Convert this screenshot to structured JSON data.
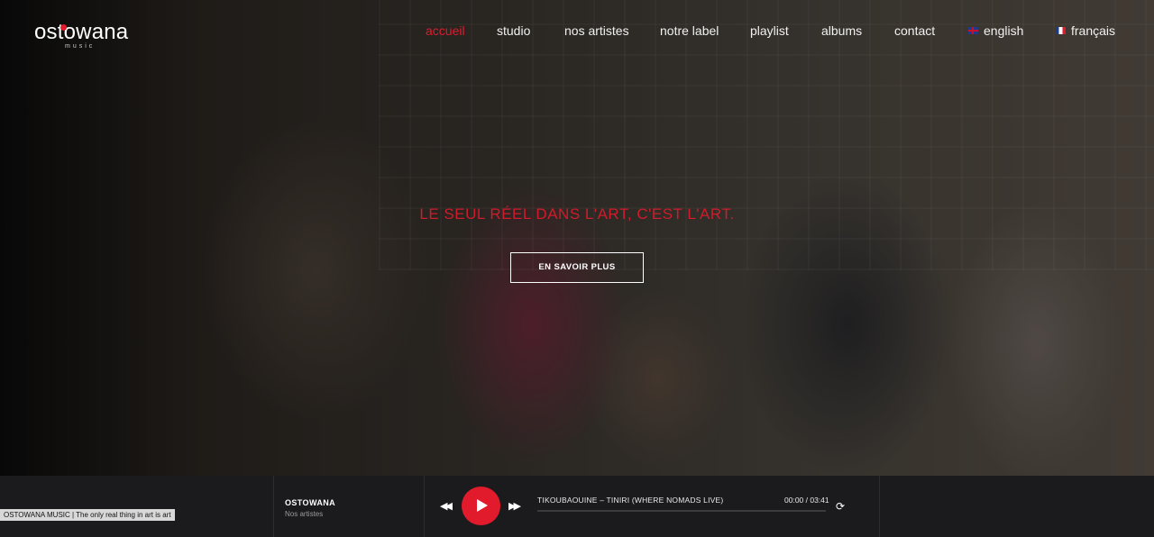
{
  "brand": {
    "logo_main": "ostowana",
    "logo_sub": "music"
  },
  "nav": {
    "items": [
      {
        "label": "accueil",
        "active": true
      },
      {
        "label": "studio"
      },
      {
        "label": "nos artistes"
      },
      {
        "label": "notre label"
      },
      {
        "label": "playlist"
      },
      {
        "label": "albums"
      },
      {
        "label": "contact"
      }
    ],
    "lang_en": {
      "label": "english",
      "icon": "uk-flag-icon"
    },
    "lang_fr": {
      "label": "français",
      "icon": "france-flag-icon"
    }
  },
  "hero": {
    "tagline": "LE SEUL RÉEL DANS L'ART, C'EST L'ART.",
    "cta_label": "EN SAVOIR PLUS"
  },
  "player": {
    "caption": "OSTOWANA MUSIC | The only real thing in art is art",
    "artist": "OSTOWANA",
    "artist_sub": "Nos artistes",
    "track_title": "TIKOUBAOUINE – TINIRI (WHERE NOMADS LIVE)",
    "time_current": "00:00",
    "time_total": "03:41",
    "time_display": "00:00 / 03:41",
    "progress_fraction": 0.0,
    "icons": {
      "prev": "skip-back-icon",
      "play": "play-icon",
      "next": "skip-forward-icon",
      "repeat": "repeat-icon"
    }
  },
  "colors": {
    "accent": "#e21b2c",
    "player_bg": "#1b1b1e",
    "text": "#ffffff"
  }
}
